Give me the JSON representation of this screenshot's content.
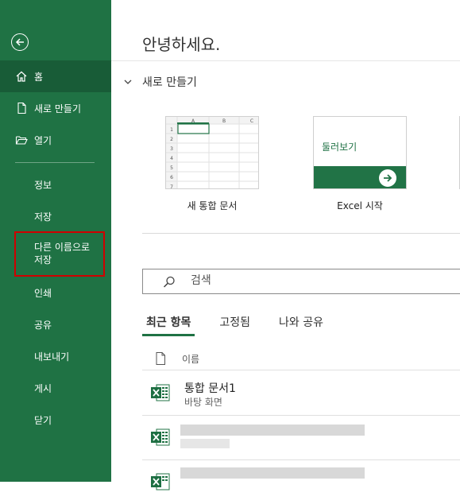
{
  "sidebar": {
    "items": [
      {
        "label": "홈",
        "icon": "home-icon",
        "active": true
      },
      {
        "label": "새로 만들기",
        "icon": "new-file-icon"
      },
      {
        "label": "열기",
        "icon": "open-folder-icon"
      },
      {
        "label": "정보"
      },
      {
        "label": "저장"
      },
      {
        "label_line1": "다른 이름으로",
        "label_line2": "저장"
      },
      {
        "label": "인쇄"
      },
      {
        "label": "공유"
      },
      {
        "label": "내보내기"
      },
      {
        "label": "게시"
      },
      {
        "label": "닫기"
      }
    ],
    "colors": {
      "background": "#1f7244",
      "active": "#185c37",
      "highlight_box": "#d00000"
    }
  },
  "main": {
    "greeting": "안녕하세요.",
    "new_section": {
      "title": "새로 만들기",
      "templates": [
        {
          "label": "새 통합 문서",
          "grid_cols": [
            "A",
            "B",
            "C"
          ],
          "grid_rows": [
            "1",
            "2",
            "3",
            "4",
            "5",
            "6",
            "7"
          ]
        },
        {
          "label": "Excel 시작",
          "tile_text": "둘러보기"
        }
      ]
    },
    "search": {
      "placeholder": "검색"
    },
    "tabs": [
      {
        "label": "최근 항목",
        "active": true
      },
      {
        "label": "고정됨"
      },
      {
        "label": "나와 공유"
      }
    ],
    "file_list": {
      "column_name": "이름",
      "files": [
        {
          "name": "통합 문서1",
          "location": "바탕 화면"
        }
      ]
    }
  }
}
